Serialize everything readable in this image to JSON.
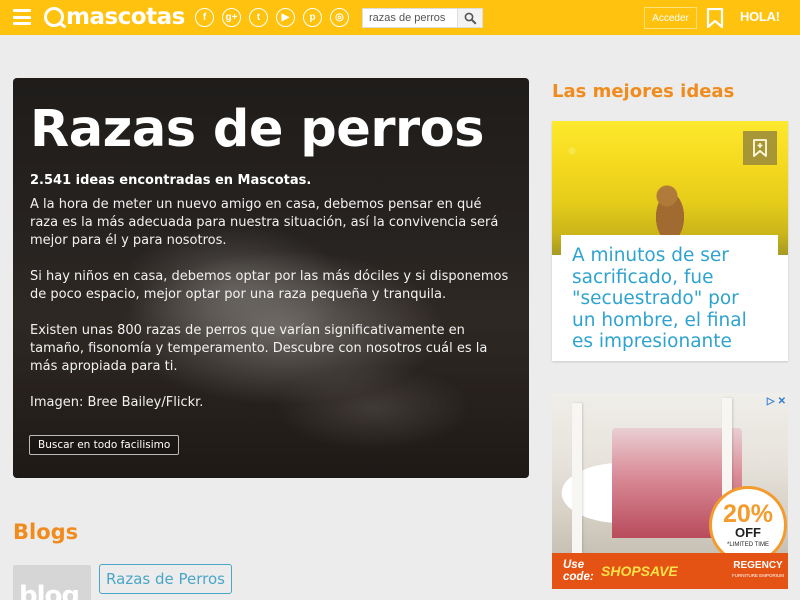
{
  "header": {
    "logo_text": "mascotas",
    "social_icons": [
      "facebook-icon",
      "google-plus-icon",
      "twitter-icon",
      "youtube-icon",
      "pinterest-icon",
      "instagram-icon"
    ],
    "social_glyphs": [
      "f",
      "g+",
      "t",
      "▶",
      "p",
      "◎"
    ],
    "search_value": "razas de perros",
    "login_label": "Acceder",
    "hola_label": "HOLA!"
  },
  "hero": {
    "title": "Razas de perros",
    "count": "2.541 ideas encontradas en Mascotas.",
    "paragraphs": [
      "A la hora de meter un nuevo amigo en casa, debemos pensar en qué raza es la más adecuada para nuestra situación, así la convivencia será mejor para él y para nosotros.",
      "Si hay niños en casa, debemos optar por las más dóciles y si disponemos de poco espacio, mejor optar por una raza pequeña y tranquila.",
      "Existen unas 800 razas de perros que varían significativamente en tamaño, fisonomía y temperamento. Descubre con nosotros cuál es la más apropiada para ti.",
      "Imagen: Bree Bailey/Flickr."
    ],
    "button_label": "Buscar en todo facilisimo"
  },
  "blogs": {
    "title": "Blogs",
    "thumb_text": "blog",
    "tag_label": "Razas de Perros"
  },
  "sidebar": {
    "title": "Las mejores ideas",
    "card_text": "A minutos de ser sacrificado, fue \"secuestrado\" por un hombre, el final es impresionante"
  },
  "ad": {
    "discount": "20%",
    "off": "OFF",
    "limited": "*LIMITED TIME",
    "use_code": "Use code:",
    "code": "SHOPSAVE",
    "brand": "REGENCY",
    "brand_sub": "FURNITURE EMPORIUM"
  },
  "colors": {
    "topbar": "#ffc20e",
    "accent_orange": "#f08c1e",
    "link_blue": "#2ea3cf"
  }
}
